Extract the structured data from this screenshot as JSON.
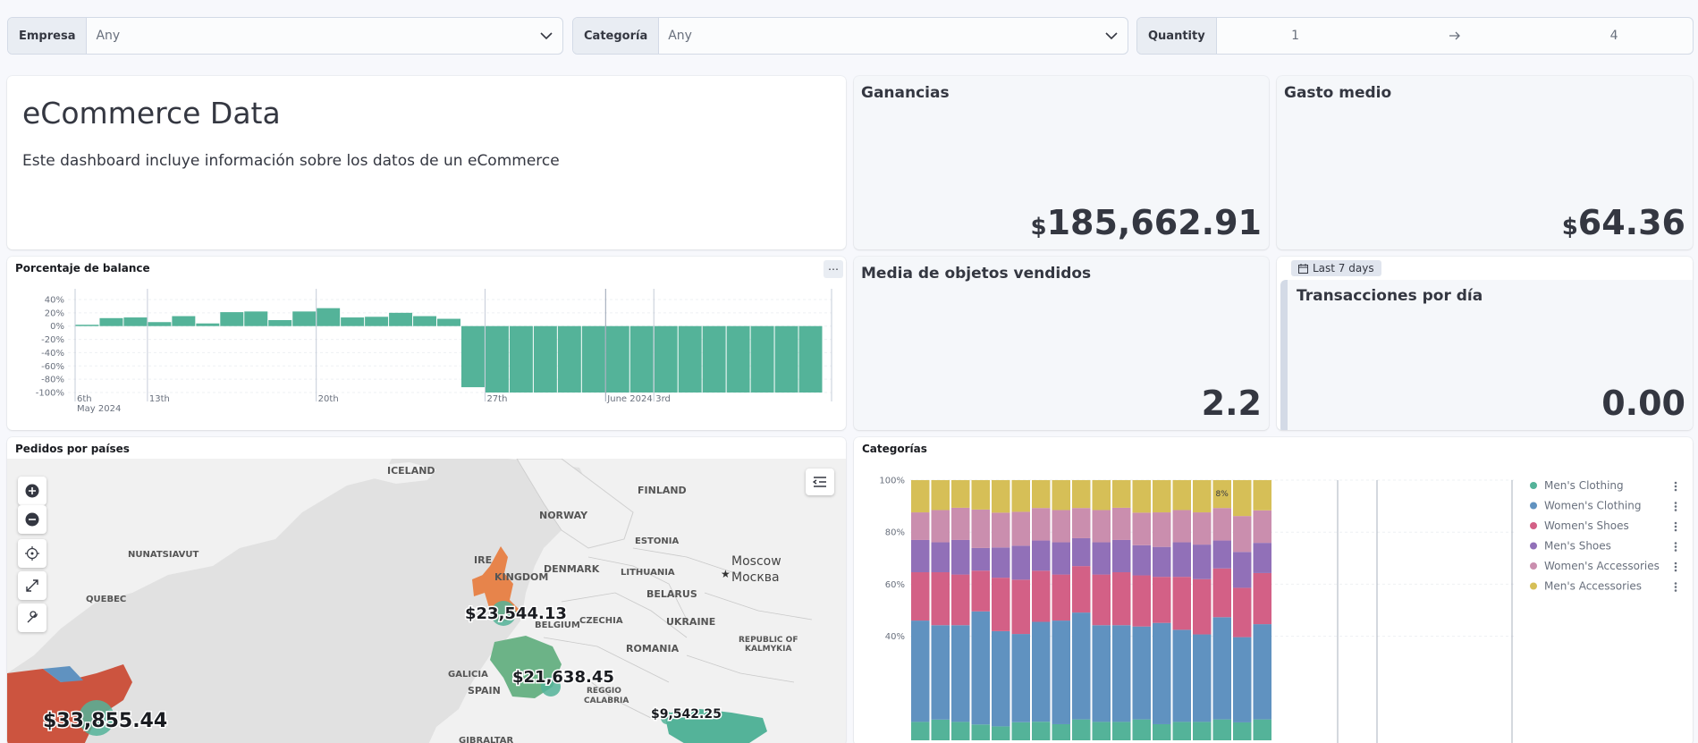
{
  "filters": [
    {
      "label": "Empresa",
      "value": "Any"
    },
    {
      "label": "Categoría",
      "value": "Any"
    },
    {
      "label": "Quantity",
      "from": "1",
      "to": "4"
    }
  ],
  "markdown": {
    "title": "eCommerce Data",
    "text": "Este dashboard incluye información sobre los datos de un eCommerce"
  },
  "metrics": {
    "ganancias": {
      "title": "Ganancias",
      "currency": "$",
      "value": "185,662.91"
    },
    "gasto_medio": {
      "title": "Gasto medio",
      "currency": "$",
      "value": "64.36"
    },
    "media_objetos": {
      "title": "Media de objetos vendidos",
      "value": "2.2"
    },
    "transacciones": {
      "title": "Transacciones por día",
      "value": "0.00",
      "badge": "Last 7 days"
    }
  },
  "balance_chart": {
    "title": "Porcentaje de balance",
    "more_label": "⋯",
    "chart_data": {
      "type": "bar",
      "yticks": [
        "40%",
        "20%",
        "0%",
        "-20%",
        "-40%",
        "-60%",
        "-80%",
        "-100%"
      ],
      "ylim": [
        -100,
        40
      ],
      "xticks": [
        {
          "label": "6th",
          "sub": "May 2024",
          "index": 0
        },
        {
          "label": "13th",
          "sub": "",
          "index": 3
        },
        {
          "label": "20th",
          "sub": "",
          "index": 10
        },
        {
          "label": "27th",
          "sub": "",
          "index": 17
        },
        {
          "label": "June 2024",
          "sub": "",
          "index": 22
        },
        {
          "label": "3rd",
          "sub": "",
          "index": 24
        }
      ],
      "values": [
        2,
        12,
        13,
        6,
        15,
        4,
        21,
        22,
        9,
        22,
        27,
        13,
        14,
        20,
        15,
        11,
        -92,
        -100,
        -100,
        -100,
        -100,
        -100,
        -100,
        -100,
        -100,
        -100,
        -100,
        -100,
        -100,
        -100,
        -100
      ],
      "color": "#54b399"
    }
  },
  "map": {
    "title": "Pedidos por países",
    "places": [
      "ICELAND",
      "FINLAND",
      "NORWAY",
      "ESTONIA",
      "NUNATSIAVUT",
      "DENMARK",
      "LITHUANIA",
      "BELARUS",
      "Moscow",
      "Москва",
      "QUEBEC",
      "CZECHIA",
      "UKRAINE",
      "REPUBLIC OF",
      "KALMYKIA",
      "ROMANIA",
      "GALICIA",
      "SPAIN",
      "REGGIO",
      "CALABRIA",
      "GIBRALTAR",
      "KINGDOM",
      "BELGIUM"
    ],
    "bubbles": {
      "uk": "$23,544.13",
      "france": "$21,638.45",
      "turkey": "$9,542.25",
      "usa": "$33,855.44"
    }
  },
  "categories_chart": {
    "title": "Categorías",
    "yticks": [
      "100%",
      "80%",
      "60%",
      "40%"
    ],
    "bar_label": "8%",
    "legend": [
      {
        "name": "Men's Clothing",
        "color": "#54b399"
      },
      {
        "name": "Women's Clothing",
        "color": "#6092c0"
      },
      {
        "name": "Women's Shoes",
        "color": "#d36086"
      },
      {
        "name": "Men's Shoes",
        "color": "#9170b8"
      },
      {
        "name": "Women's Accessories",
        "color": "#ca8eae"
      },
      {
        "name": "Men's Accessories",
        "color": "#d6bf57"
      }
    ],
    "chart_data": {
      "type": "bar",
      "stacked_percent": true,
      "ylim": [
        30,
        100
      ],
      "series_order": [
        "Men's Clothing",
        "Women's Clothing",
        "Women's Shoes",
        "Men's Shoes",
        "Women's Accessories",
        "Men's Accessories"
      ],
      "bars": [
        [
          8,
          44,
          21,
          14,
          12,
          14
        ],
        [
          9,
          41,
          23,
          13,
          14,
          13
        ],
        [
          8,
          42,
          22,
          15,
          14,
          12
        ],
        [
          7,
          50,
          18,
          10,
          17,
          13
        ],
        [
          6,
          41,
          23,
          13,
          15,
          14
        ],
        [
          8,
          39,
          24,
          15,
          15,
          14
        ],
        [
          8,
          43,
          22,
          13,
          14,
          12
        ],
        [
          7,
          45,
          20,
          14,
          14,
          13
        ],
        [
          9,
          46,
          20,
          12,
          13,
          12
        ],
        [
          8,
          42,
          22,
          14,
          14,
          13
        ],
        [
          8,
          42,
          23,
          14,
          14,
          12
        ],
        [
          9,
          40,
          22,
          13,
          14,
          14
        ],
        [
          7,
          44,
          20,
          13,
          15,
          14
        ],
        [
          8,
          40,
          23,
          15,
          14,
          13
        ],
        [
          8,
          38,
          24,
          15,
          14,
          14
        ],
        [
          9,
          44,
          21,
          12,
          14,
          12
        ],
        [
          8,
          38,
          22,
          16,
          16,
          16
        ],
        [
          9,
          41,
          22,
          13,
          14,
          13
        ]
      ]
    }
  }
}
